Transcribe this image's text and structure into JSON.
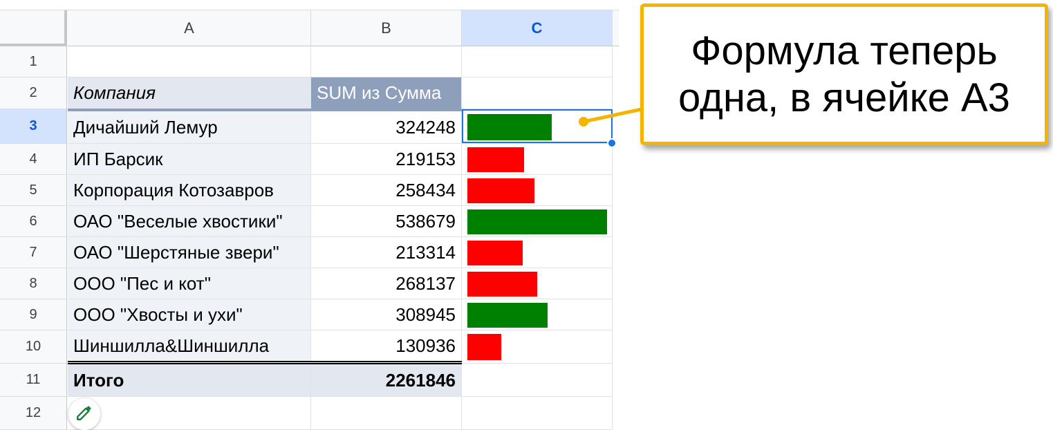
{
  "columns": [
    "A",
    "B",
    "C"
  ],
  "selected_column": "C",
  "rows": [
    "1",
    "2",
    "3",
    "4",
    "5",
    "6",
    "7",
    "8",
    "9",
    "10",
    "11",
    "12"
  ],
  "selected_row": "3",
  "table": {
    "header": {
      "company": "Компания",
      "sum": "SUM из Сумма"
    },
    "items": [
      {
        "company": "Дичайший Лемур",
        "sum": "324248",
        "bar_value": 324248,
        "bar_color": "#008000"
      },
      {
        "company": "ИП Барсик",
        "sum": "219153",
        "bar_value": 219153,
        "bar_color": "#ff0000"
      },
      {
        "company": "Корпорация Котозавров",
        "sum": "258434",
        "bar_value": 258434,
        "bar_color": "#ff0000"
      },
      {
        "company": "ОАО \"Веселые хвостики\"",
        "sum": "538679",
        "bar_value": 538679,
        "bar_color": "#008000"
      },
      {
        "company": "ОАО \"Шерстяные звери\"",
        "sum": "213314",
        "bar_value": 213314,
        "bar_color": "#ff0000"
      },
      {
        "company": "ООО \"Пес и кот\"",
        "sum": "268137",
        "bar_value": 268137,
        "bar_color": "#ff0000"
      },
      {
        "company": "ООО \"Хвосты и ухи\"",
        "sum": "308945",
        "bar_value": 308945,
        "bar_color": "#008000"
      },
      {
        "company": "Шиншилла&Шиншилла",
        "sum": "130936",
        "bar_value": 130936,
        "bar_color": "#ff0000"
      }
    ],
    "total": {
      "label": "Итого",
      "value": "2261846"
    }
  },
  "callout": {
    "line1": "Формула теперь",
    "line2": "одна, в ячейке A3"
  },
  "colors": {
    "accent": "#1a73e8",
    "callout_border": "#f4b400",
    "positive_bar": "#008000",
    "negative_bar": "#ff0000",
    "header_fill": "#8d9fba"
  },
  "icons": {
    "edit_button": "pencil-icon"
  }
}
